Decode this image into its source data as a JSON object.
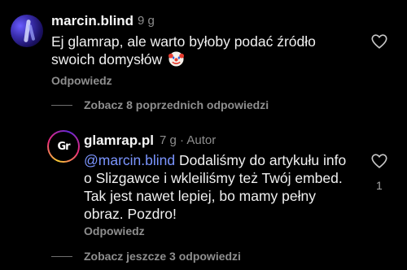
{
  "comment1": {
    "username": "marcin.blind",
    "time": "9 g",
    "text": "Ej glamrap, ale warto byłoby podać źródło",
    "text_line2": "swoich domysłów",
    "emoji": "clown-face-emoji",
    "reply_label": "Odpowiedz",
    "like_icon": "heart-outline-icon"
  },
  "view_previous": "Zobacz 8 poprzednich odpowiedzi",
  "comment2": {
    "username": "glamrap.pl",
    "time": "7 g",
    "separator": "·",
    "author_badge": "Autor",
    "mention": "@marcin.blind",
    "text_line1": " Dodaliśmy do artykułu info",
    "text_line2": "o Slizgawce i wkleiliśmy też Twój embed.",
    "text_line3": "Tak jest nawet lepiej, bo mamy pełny",
    "text_line4": "obraz. Pozdro!",
    "reply_label": "Odpowiedz",
    "like_icon": "heart-outline-icon",
    "like_count": "1",
    "avatar_logo": "Gr"
  },
  "view_more": "Zobacz jeszcze 3 odpowiedzi",
  "colors": {
    "background": "#000000",
    "mention": "#7b95ff",
    "secondary_text": "#8e8e8e"
  }
}
